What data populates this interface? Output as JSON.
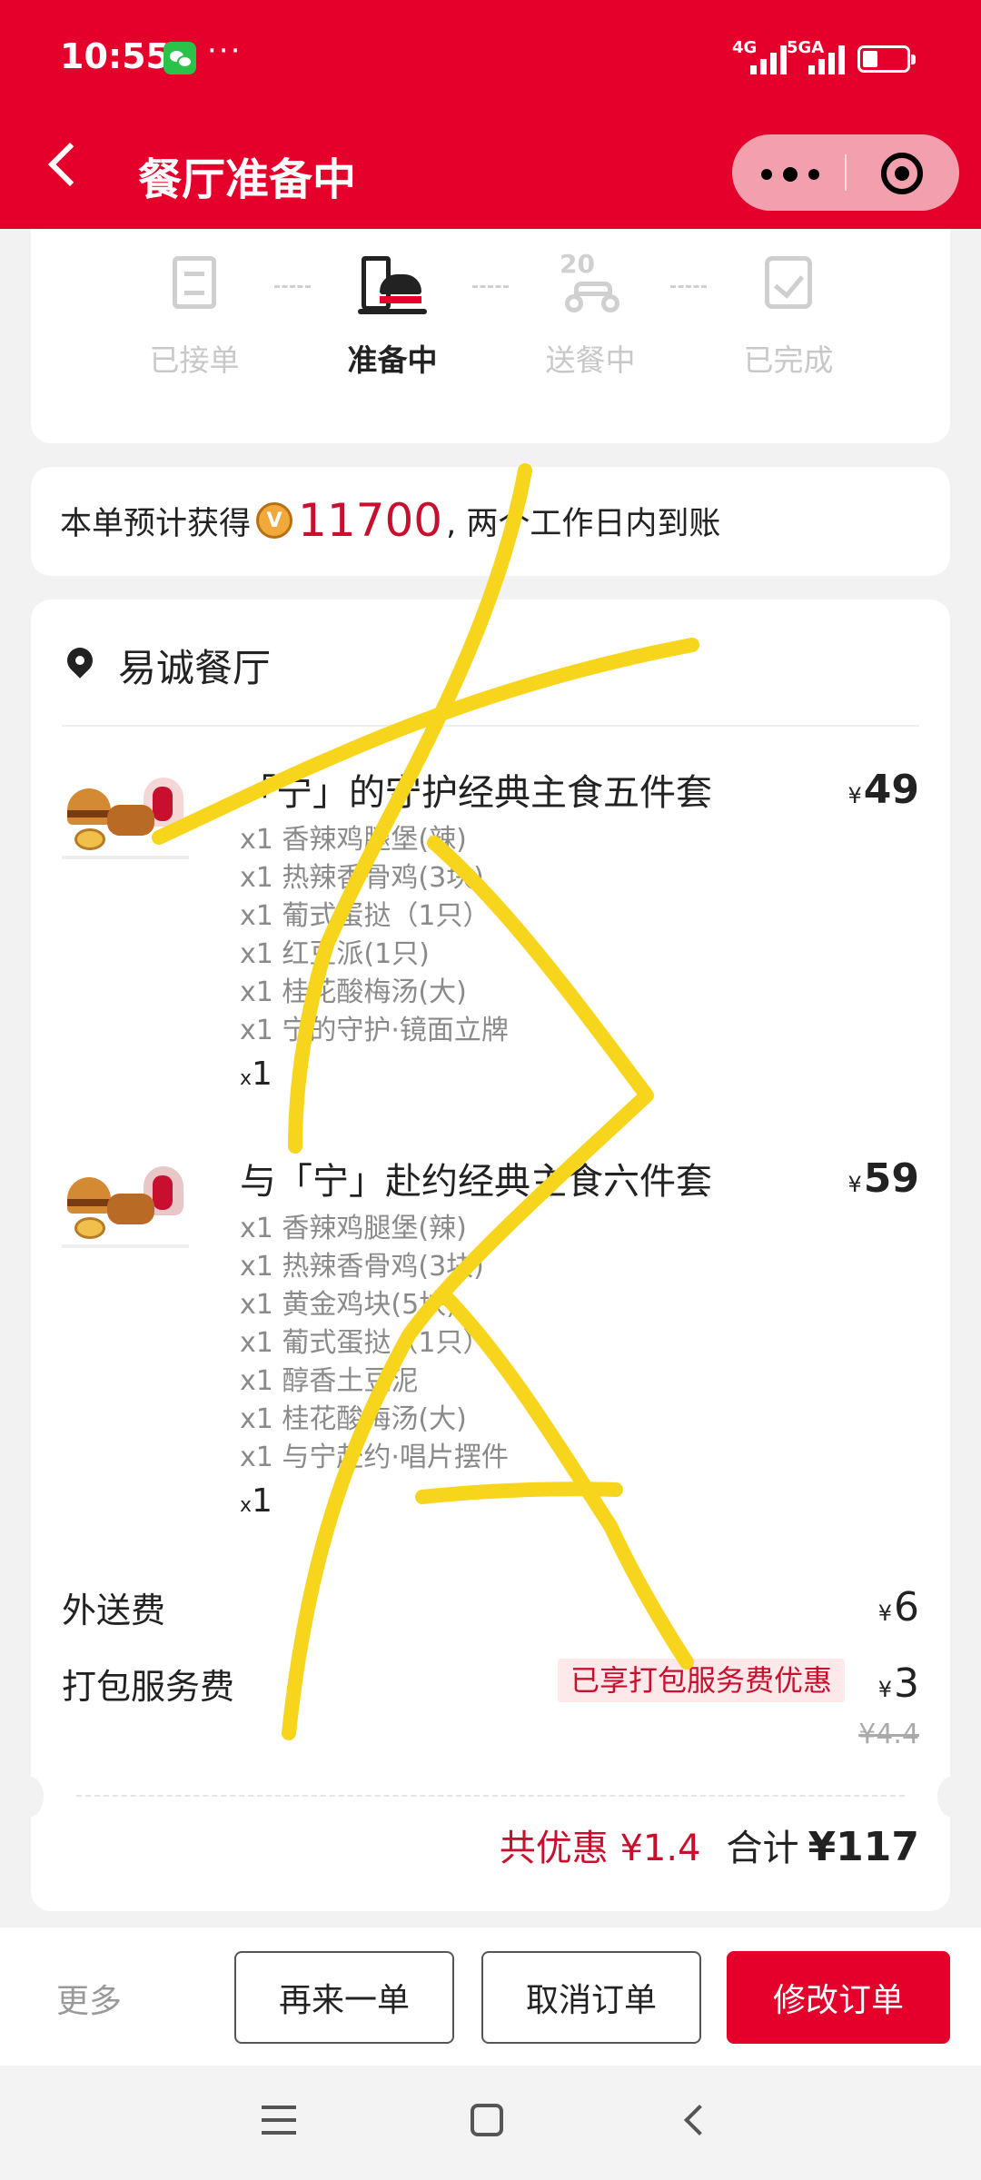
{
  "status_bar": {
    "time": "10:55",
    "more": "···",
    "network_1": "4G",
    "network_2": "5GA"
  },
  "header": {
    "title": "餐厅准备中"
  },
  "progress": {
    "steps": [
      {
        "label": "已接单",
        "icon": "receipt-icon",
        "active": false
      },
      {
        "label": "准备中",
        "icon": "burger-meal-icon",
        "active": true
      },
      {
        "label": "送餐中",
        "icon": "delivery-scooter-icon",
        "badge": "20",
        "active": false
      },
      {
        "label": "已完成",
        "icon": "completed-check-icon",
        "active": false
      }
    ]
  },
  "points": {
    "prefix": "本单预计获得",
    "coin_letter": "V",
    "amount": "11700",
    "suffix": ", 两个工作日内到账"
  },
  "order": {
    "restaurant": "易诚餐厅",
    "items": [
      {
        "name": "「宁」的守护经典主食五件套",
        "currency": "¥",
        "price": "49",
        "subs": [
          "x1 香辣鸡腿堡(辣)",
          "x1 热辣香骨鸡(3块)",
          "x1 葡式蛋挞（1只）",
          "x1 红豆派(1只)",
          "x1 桂花酸梅汤(大)",
          "x1 宁的守护·镜面立牌"
        ],
        "qty_x": "x",
        "qty": "1"
      },
      {
        "name": "与「宁」赴约经典主食六件套",
        "currency": "¥",
        "price": "59",
        "subs": [
          "x1 香辣鸡腿堡(辣)",
          "x1 热辣香骨鸡(3块)",
          "x1 黄金鸡块(5块)",
          "x1 葡式蛋挞（1只）",
          "x1 醇香土豆泥",
          "x1 桂花酸梅汤(大)",
          "x1 与宁赴约·唱片摆件"
        ],
        "qty_x": "x",
        "qty": "1"
      }
    ],
    "delivery_fee": {
      "label": "外送费",
      "currency": "¥",
      "amount": "6"
    },
    "packing_fee": {
      "label": "打包服务费",
      "promo": "已享打包服务费优惠",
      "currency": "¥",
      "amount": "3",
      "original": "¥4.4"
    },
    "discount": "共优惠 ¥1.4",
    "total_label": "合计",
    "total": "¥117"
  },
  "bottom_bar": {
    "more": "更多",
    "reorder": "再来一单",
    "cancel": "取消订单",
    "modify": "修改订单"
  },
  "colors": {
    "brand_red": "#e4002b",
    "price_red": "#c8102e",
    "scribble_yellow": "#f7d51d"
  }
}
